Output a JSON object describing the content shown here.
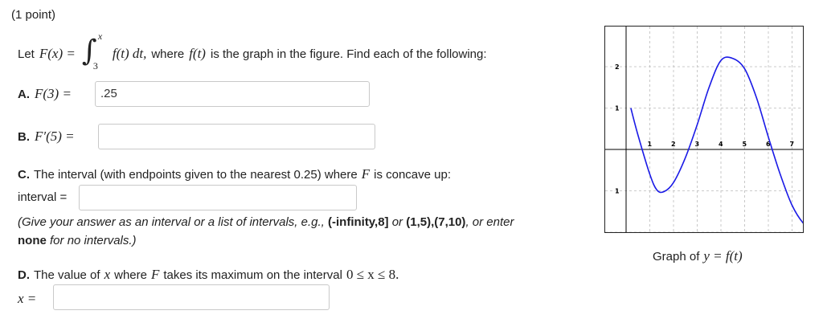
{
  "problem": {
    "points": "(1 point)",
    "intro_prefix": "Let",
    "intro_fx": "F(x) =",
    "integral_upper": "x",
    "integral_lower": "3",
    "integrand": "f(t) dt,",
    "intro_suffix_1": "where",
    "intro_ft": "f(t)",
    "intro_suffix_2": "is the graph in the figure. Find each of the following:"
  },
  "parts": {
    "a": {
      "label": "A.",
      "expr": "F(3) =",
      "value": ".25"
    },
    "b": {
      "label": "B.",
      "expr": "F′(5) =",
      "value": ""
    },
    "c": {
      "label": "C.",
      "text_1": "The interval (with endpoints given to the nearest 0.25) where",
      "var": "F",
      "text_2": "is concave up:",
      "interval_label": "interval =",
      "value": "",
      "hint_1": "(Give your answer as an interval or a list of intervals, e.g.,",
      "hint_ex1": "(-infinity,8]",
      "hint_or1": "or",
      "hint_ex2": "(1,5),(7,10)",
      "hint_or2": ", or enter",
      "hint_none": "none",
      "hint_end": "for no intervals.)"
    },
    "d": {
      "label": "D.",
      "text_1": "The value of",
      "var_x": "x",
      "text_2": "where",
      "var_F": "F",
      "text_3": "takes its maximum on the interval",
      "interval": "0 ≤ x ≤ 8.",
      "answer_label": "x =",
      "value": ""
    }
  },
  "figure": {
    "caption_prefix": "Graph of",
    "caption_math": "y = f(t)",
    "curve_color": "#1a1ae6",
    "x_tick_labels": [
      "1",
      "2",
      "3",
      "4",
      "5",
      "6",
      "7"
    ],
    "y_tick_labels": [
      "2",
      "1",
      "1"
    ]
  },
  "chart_data": {
    "type": "line",
    "title": "",
    "xlabel": "",
    "ylabel": "",
    "xlim": [
      0,
      8
    ],
    "ylim": [
      -2,
      3
    ],
    "grid": true,
    "series": [
      {
        "x": [
          0.2,
          0.5,
          1.0,
          1.3,
          1.6,
          2.0,
          2.5,
          3.0,
          3.5,
          4.0,
          4.5,
          5.0,
          5.5,
          6.0,
          6.5,
          7.0,
          7.5,
          8.0
        ],
        "y": [
          1.0,
          0.35,
          -0.6,
          -0.98,
          -1.02,
          -0.8,
          -0.2,
          0.6,
          1.5,
          2.15,
          2.2,
          1.95,
          1.25,
          0.3,
          -0.6,
          -1.35,
          -1.8,
          -2.0
        ]
      }
    ]
  }
}
